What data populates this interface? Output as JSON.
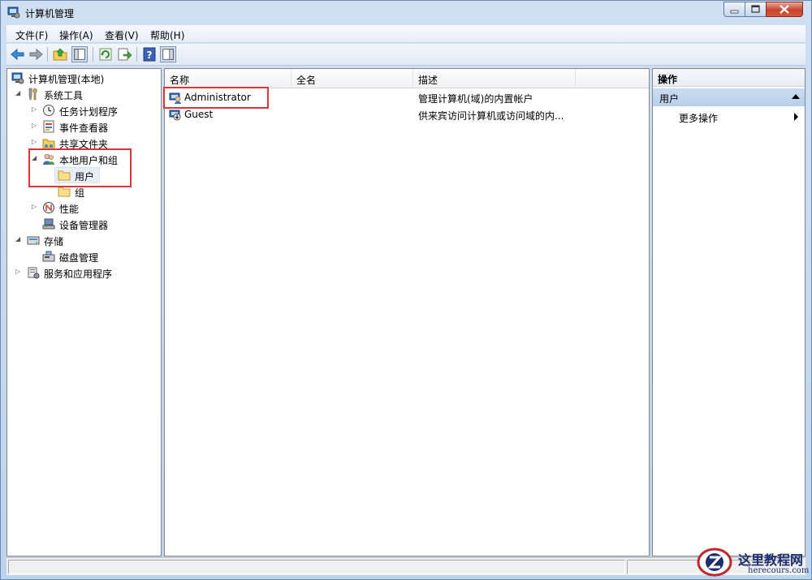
{
  "window": {
    "title": "计算机管理",
    "controls": [
      "minimize",
      "maximize",
      "close"
    ]
  },
  "menu": [
    {
      "label": "文件(F)"
    },
    {
      "label": "操作(A)"
    },
    {
      "label": "查看(V)"
    },
    {
      "label": "帮助(H)"
    }
  ],
  "toolbar": {
    "icons": [
      "back-icon",
      "forward-icon",
      "up-folder-icon",
      "show-hide-tree-icon",
      "refresh-icon",
      "export-list-icon",
      "help-icon",
      "show-hide-action-pane-icon"
    ]
  },
  "tree": {
    "root": "计算机管理(本地)",
    "system_tools": "系统工具",
    "task_scheduler": "任务计划程序",
    "event_viewer": "事件查看器",
    "shared_folders": "共享文件夹",
    "local_users_groups": "本地用户和组",
    "users": "用户",
    "groups": "组",
    "performance": "性能",
    "device_manager": "设备管理器",
    "storage": "存储",
    "disk_management": "磁盘管理",
    "services_apps": "服务和应用程序"
  },
  "list": {
    "columns": [
      "名称",
      "全名",
      "描述"
    ],
    "rows": [
      {
        "name": "Administrator",
        "full_name": "",
        "description": "管理计算机(域)的内置帐户"
      },
      {
        "name": "Guest",
        "full_name": "",
        "description": "供来宾访问计算机或访问域的内..."
      }
    ]
  },
  "actions": {
    "title": "操作",
    "section": "用户",
    "more": "更多操作"
  },
  "watermark": {
    "text": "这里教程网",
    "url": "herecours.com"
  },
  "colors": {
    "highlight": "#d9363a",
    "selection": "#cadcf1"
  }
}
